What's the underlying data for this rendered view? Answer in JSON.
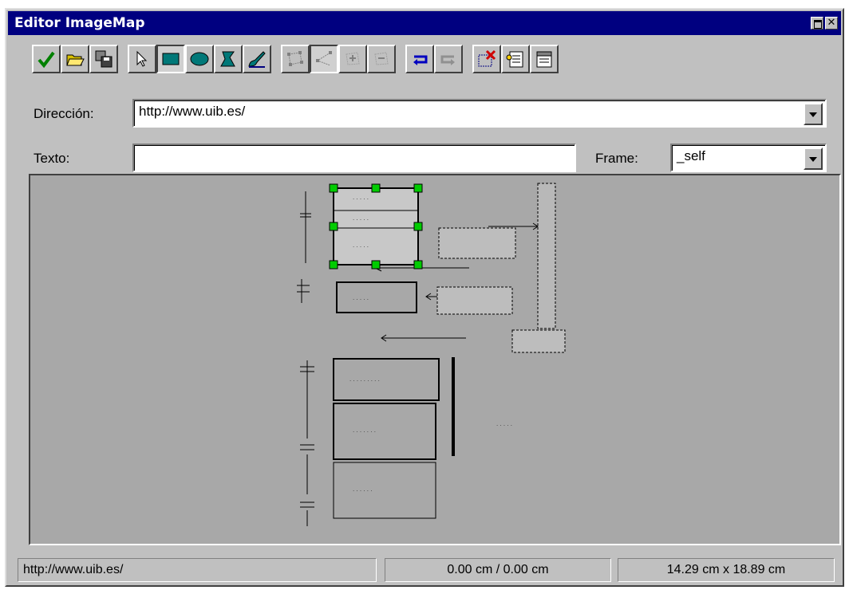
{
  "window": {
    "title": "Editor ImageMap"
  },
  "toolbar": {
    "tools": [
      "accept-icon",
      "open-icon",
      "save-icon",
      "pointer-icon",
      "rectangle-icon",
      "ellipse-icon",
      "polygon-icon",
      "freehand-icon",
      "move-points-icon",
      "add-point-icon",
      "insert-point-icon",
      "delete-point-icon",
      "undo-icon",
      "redo-icon",
      "delete-area-icon",
      "list-icon",
      "properties-icon"
    ]
  },
  "form": {
    "direccion_label": "Dirección:",
    "direccion_value": "http://www.uib.es/",
    "texto_label": "Texto:",
    "texto_value": "",
    "frame_label": "Frame:",
    "frame_value": "_self"
  },
  "statusbar": {
    "url": "http://www.uib.es/",
    "position": "0.00 cm / 0.00 cm",
    "size": "14.29 cm x 18.89 cm"
  },
  "colors": {
    "titlebar": "#000080",
    "canvas": "#a8a8a8",
    "handles": "#00cc00"
  }
}
